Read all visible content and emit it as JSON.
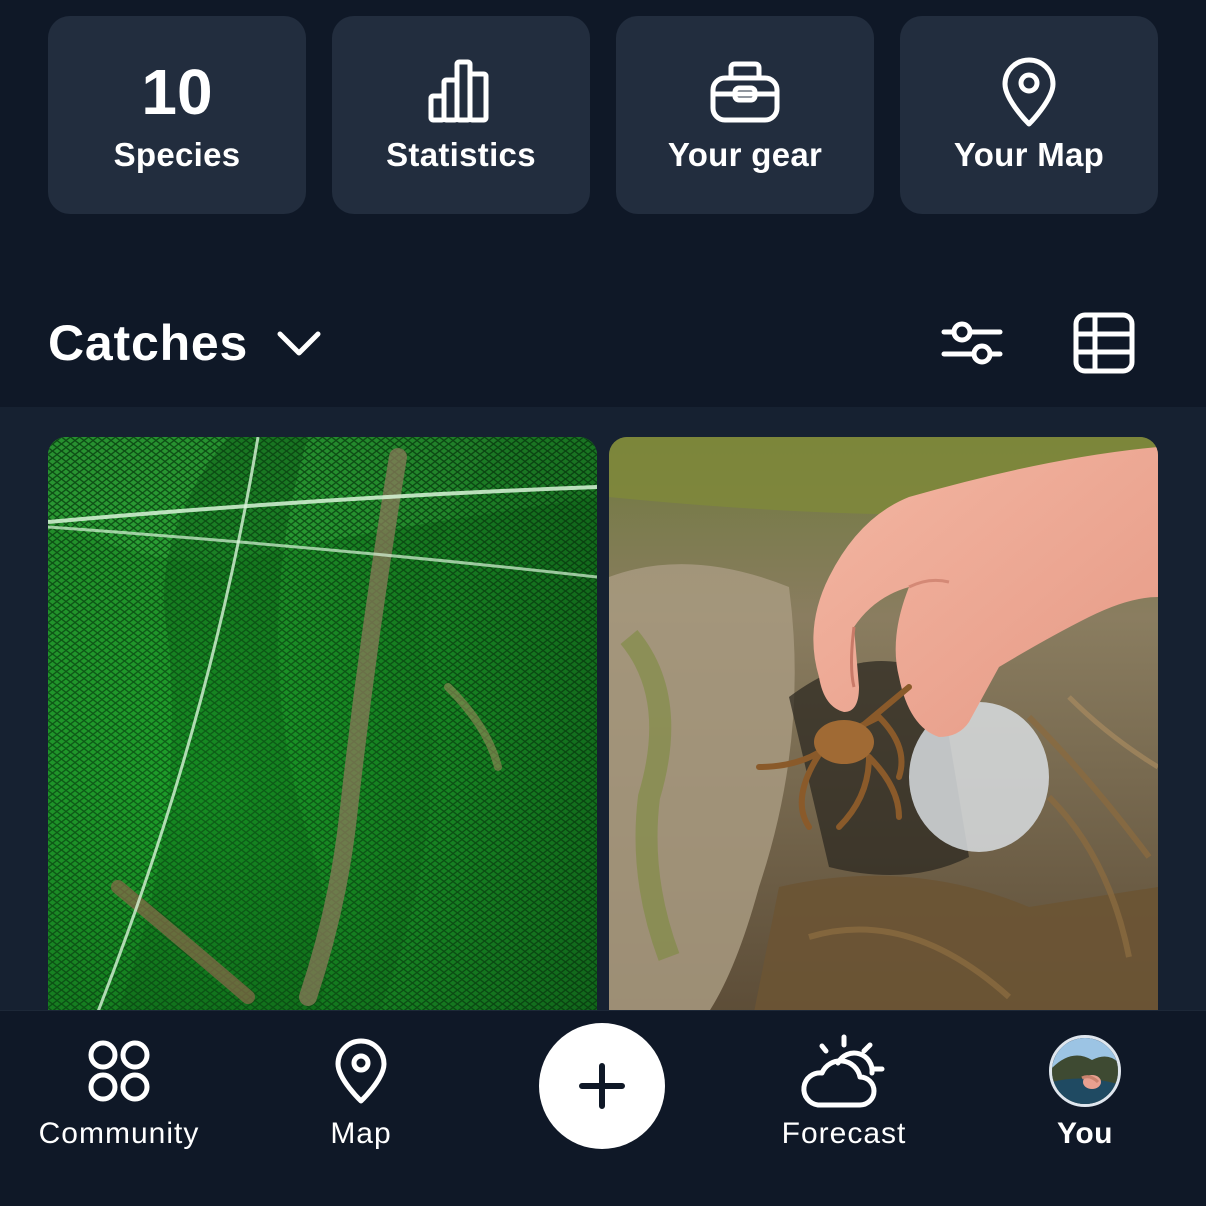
{
  "quick_access": {
    "species": {
      "count": "10",
      "label": "Species"
    },
    "statistics": {
      "label": "Statistics",
      "icon": "bar-chart-icon"
    },
    "gear": {
      "label": "Your gear",
      "icon": "tackle-box-icon"
    },
    "map": {
      "label": "Your Map",
      "icon": "location-pin-icon"
    }
  },
  "catches": {
    "title": "Catches",
    "icons": [
      "chevron-down-icon",
      "filter-sliders-icon",
      "table-view-icon"
    ],
    "photos": [
      {
        "description_icon": "catch-photo-shrimp-in-net"
      },
      {
        "description_icon": "catch-photo-crayfish-in-hand"
      }
    ]
  },
  "bottom_nav": {
    "community": {
      "label": "Community",
      "icon": "community-grid-icon"
    },
    "map": {
      "label": "Map",
      "icon": "map-pin-icon"
    },
    "add": {
      "icon": "plus-icon"
    },
    "forecast": {
      "label": "Forecast",
      "icon": "cloud-sun-icon"
    },
    "you": {
      "label": "You",
      "icon": "avatar"
    }
  },
  "colors": {
    "background": "#0f1827",
    "tile": "#222d3e",
    "grid_background": "#162131",
    "text": "#ffffff"
  }
}
